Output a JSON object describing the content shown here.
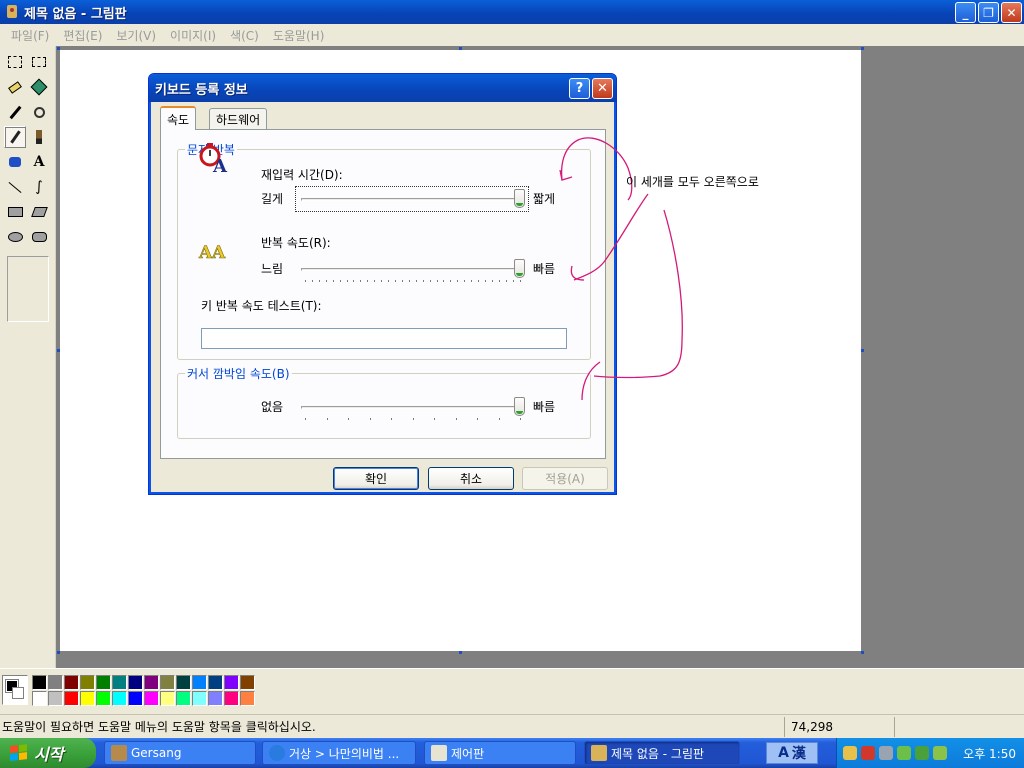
{
  "window": {
    "title": "제목 없음 - 그림판",
    "minimize_glyph": "_",
    "maximize_glyph": "❐",
    "close_glyph": "✕"
  },
  "menu": [
    "파일(F)",
    "편집(E)",
    "보기(V)",
    "이미지(I)",
    "색(C)",
    "도움말(H)"
  ],
  "tools": [
    {
      "name": "free-select-icon",
      "glyph": "⬚"
    },
    {
      "name": "rect-select-icon",
      "glyph": "▭"
    },
    {
      "name": "eraser-icon",
      "glyph": "◿"
    },
    {
      "name": "fill-icon",
      "glyph": "⛁"
    },
    {
      "name": "color-picker-icon",
      "glyph": "⁄"
    },
    {
      "name": "magnifier-icon",
      "glyph": "⌕"
    },
    {
      "name": "pencil-icon",
      "glyph": "✎"
    },
    {
      "name": "brush-icon",
      "glyph": "♜"
    },
    {
      "name": "airbrush-icon",
      "glyph": "✦"
    },
    {
      "name": "text-icon",
      "glyph": "A"
    },
    {
      "name": "line-icon",
      "glyph": "╲"
    },
    {
      "name": "curve-icon",
      "glyph": "∫"
    },
    {
      "name": "rectangle-icon",
      "glyph": "▭"
    },
    {
      "name": "polygon-icon",
      "glyph": "◇"
    },
    {
      "name": "ellipse-icon",
      "glyph": "◯"
    },
    {
      "name": "rounded-rect-icon",
      "glyph": "▢"
    }
  ],
  "palette": {
    "top": [
      "#000000",
      "#808080",
      "#800000",
      "#808000",
      "#008000",
      "#008080",
      "#000080",
      "#800080",
      "#808040",
      "#004040",
      "#0080ff",
      "#004080",
      "#8000ff",
      "#804000"
    ],
    "bottom": [
      "#ffffff",
      "#c0c0c0",
      "#ff0000",
      "#ffff00",
      "#00ff00",
      "#00ffff",
      "#0000ff",
      "#ff00ff",
      "#ffff80",
      "#00ff80",
      "#80ffff",
      "#8080ff",
      "#ff0080",
      "#ff8040"
    ]
  },
  "dialog": {
    "title": "키보드 등록 정보",
    "help_glyph": "?",
    "close_glyph": "✕",
    "tabs": [
      "속도",
      "하드웨어"
    ],
    "char_repeat": {
      "legend": "문자 반복",
      "delay_label": "재입력 시간(D):",
      "delay_min": "길게",
      "delay_max": "짧게",
      "delay_value": 1.0,
      "rate_label": "반복 속도(R):",
      "rate_min": "느림",
      "rate_max": "빠름",
      "rate_value": 1.0,
      "test_label": "키 반복 속도 테스트(T):",
      "test_value": ""
    },
    "cursor_blink": {
      "legend": "커서 깜박임 속도(B)",
      "min": "없음",
      "max": "빠름",
      "value": 1.0
    },
    "buttons": {
      "ok": "확인",
      "cancel": "취소",
      "apply": "적용(A)"
    }
  },
  "annotation": "이 세개를 모두 오른쪽으로",
  "status": {
    "help": "도움말이 필요하면 도움말 메뉴의 도움말 항목을 클릭하십시오.",
    "coords": "74,298"
  },
  "taskbar": {
    "start": "시작",
    "items": [
      "Gersang",
      "거상 > 나만의비법 ...",
      "제어판",
      "제목 없음 - 그림판"
    ],
    "lang_a": "A",
    "lang_han": "漢",
    "clock": "오후 1:50"
  },
  "colors": {
    "annotation_ink": "#d4197a",
    "xp_blue": "#0a5fd8",
    "group_legend": "#0046d5"
  }
}
